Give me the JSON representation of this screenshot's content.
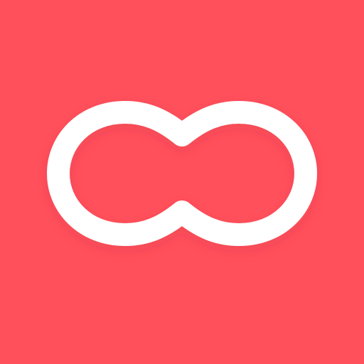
{
  "icon": {
    "logo_name": "infinity-loop-icon"
  },
  "colors": {
    "background": "#FF505C",
    "logo": "#FFFFFF",
    "shadow": "#B8323C"
  }
}
